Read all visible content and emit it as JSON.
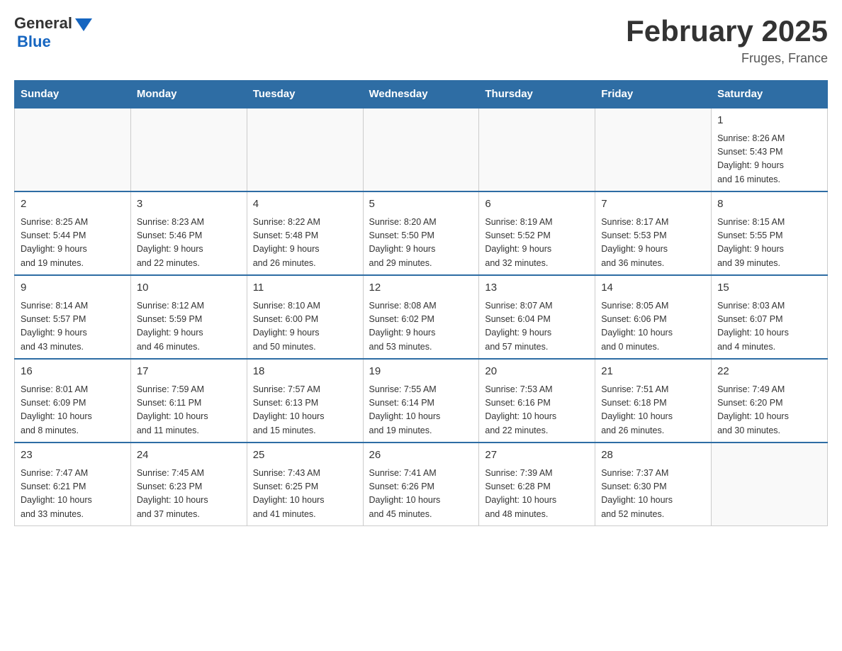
{
  "header": {
    "logo_general": "General",
    "logo_blue": "Blue",
    "title": "February 2025",
    "location": "Fruges, France"
  },
  "days_of_week": [
    "Sunday",
    "Monday",
    "Tuesday",
    "Wednesday",
    "Thursday",
    "Friday",
    "Saturday"
  ],
  "weeks": [
    [
      {
        "day": "",
        "info": ""
      },
      {
        "day": "",
        "info": ""
      },
      {
        "day": "",
        "info": ""
      },
      {
        "day": "",
        "info": ""
      },
      {
        "day": "",
        "info": ""
      },
      {
        "day": "",
        "info": ""
      },
      {
        "day": "1",
        "info": "Sunrise: 8:26 AM\nSunset: 5:43 PM\nDaylight: 9 hours\nand 16 minutes."
      }
    ],
    [
      {
        "day": "2",
        "info": "Sunrise: 8:25 AM\nSunset: 5:44 PM\nDaylight: 9 hours\nand 19 minutes."
      },
      {
        "day": "3",
        "info": "Sunrise: 8:23 AM\nSunset: 5:46 PM\nDaylight: 9 hours\nand 22 minutes."
      },
      {
        "day": "4",
        "info": "Sunrise: 8:22 AM\nSunset: 5:48 PM\nDaylight: 9 hours\nand 26 minutes."
      },
      {
        "day": "5",
        "info": "Sunrise: 8:20 AM\nSunset: 5:50 PM\nDaylight: 9 hours\nand 29 minutes."
      },
      {
        "day": "6",
        "info": "Sunrise: 8:19 AM\nSunset: 5:52 PM\nDaylight: 9 hours\nand 32 minutes."
      },
      {
        "day": "7",
        "info": "Sunrise: 8:17 AM\nSunset: 5:53 PM\nDaylight: 9 hours\nand 36 minutes."
      },
      {
        "day": "8",
        "info": "Sunrise: 8:15 AM\nSunset: 5:55 PM\nDaylight: 9 hours\nand 39 minutes."
      }
    ],
    [
      {
        "day": "9",
        "info": "Sunrise: 8:14 AM\nSunset: 5:57 PM\nDaylight: 9 hours\nand 43 minutes."
      },
      {
        "day": "10",
        "info": "Sunrise: 8:12 AM\nSunset: 5:59 PM\nDaylight: 9 hours\nand 46 minutes."
      },
      {
        "day": "11",
        "info": "Sunrise: 8:10 AM\nSunset: 6:00 PM\nDaylight: 9 hours\nand 50 minutes."
      },
      {
        "day": "12",
        "info": "Sunrise: 8:08 AM\nSunset: 6:02 PM\nDaylight: 9 hours\nand 53 minutes."
      },
      {
        "day": "13",
        "info": "Sunrise: 8:07 AM\nSunset: 6:04 PM\nDaylight: 9 hours\nand 57 minutes."
      },
      {
        "day": "14",
        "info": "Sunrise: 8:05 AM\nSunset: 6:06 PM\nDaylight: 10 hours\nand 0 minutes."
      },
      {
        "day": "15",
        "info": "Sunrise: 8:03 AM\nSunset: 6:07 PM\nDaylight: 10 hours\nand 4 minutes."
      }
    ],
    [
      {
        "day": "16",
        "info": "Sunrise: 8:01 AM\nSunset: 6:09 PM\nDaylight: 10 hours\nand 8 minutes."
      },
      {
        "day": "17",
        "info": "Sunrise: 7:59 AM\nSunset: 6:11 PM\nDaylight: 10 hours\nand 11 minutes."
      },
      {
        "day": "18",
        "info": "Sunrise: 7:57 AM\nSunset: 6:13 PM\nDaylight: 10 hours\nand 15 minutes."
      },
      {
        "day": "19",
        "info": "Sunrise: 7:55 AM\nSunset: 6:14 PM\nDaylight: 10 hours\nand 19 minutes."
      },
      {
        "day": "20",
        "info": "Sunrise: 7:53 AM\nSunset: 6:16 PM\nDaylight: 10 hours\nand 22 minutes."
      },
      {
        "day": "21",
        "info": "Sunrise: 7:51 AM\nSunset: 6:18 PM\nDaylight: 10 hours\nand 26 minutes."
      },
      {
        "day": "22",
        "info": "Sunrise: 7:49 AM\nSunset: 6:20 PM\nDaylight: 10 hours\nand 30 minutes."
      }
    ],
    [
      {
        "day": "23",
        "info": "Sunrise: 7:47 AM\nSunset: 6:21 PM\nDaylight: 10 hours\nand 33 minutes."
      },
      {
        "day": "24",
        "info": "Sunrise: 7:45 AM\nSunset: 6:23 PM\nDaylight: 10 hours\nand 37 minutes."
      },
      {
        "day": "25",
        "info": "Sunrise: 7:43 AM\nSunset: 6:25 PM\nDaylight: 10 hours\nand 41 minutes."
      },
      {
        "day": "26",
        "info": "Sunrise: 7:41 AM\nSunset: 6:26 PM\nDaylight: 10 hours\nand 45 minutes."
      },
      {
        "day": "27",
        "info": "Sunrise: 7:39 AM\nSunset: 6:28 PM\nDaylight: 10 hours\nand 48 minutes."
      },
      {
        "day": "28",
        "info": "Sunrise: 7:37 AM\nSunset: 6:30 PM\nDaylight: 10 hours\nand 52 minutes."
      },
      {
        "day": "",
        "info": ""
      }
    ]
  ]
}
